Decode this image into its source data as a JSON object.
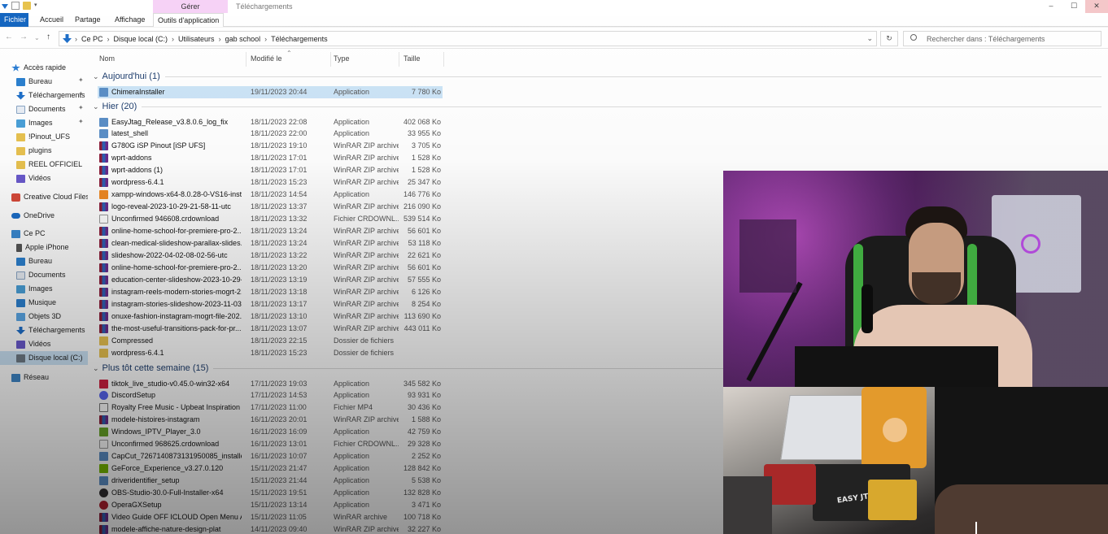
{
  "window": {
    "title": "Téléchargements",
    "context_tab": "Gérer"
  },
  "ribbon": {
    "tabs": [
      "Fichier",
      "Accueil",
      "Partage",
      "Affichage",
      "Outils d'application"
    ]
  },
  "address": {
    "crumbs": [
      "Ce PC",
      "Disque local (C:)",
      "Utilisateurs",
      "gab school",
      "Téléchargements"
    ],
    "search_placeholder": "Rechercher dans : Téléchargements"
  },
  "sidebar": {
    "items": [
      {
        "label": "Accès rapide",
        "icon": "star-icon",
        "pinned": false
      },
      {
        "label": "Bureau",
        "icon": "desktop-icon",
        "pinned": true
      },
      {
        "label": "Téléchargements",
        "icon": "download-icon",
        "pinned": true
      },
      {
        "label": "Documents",
        "icon": "documents-icon",
        "pinned": true
      },
      {
        "label": "Images",
        "icon": "images-icon",
        "pinned": true
      },
      {
        "label": "!Pinout_UFS",
        "icon": "folder-icon",
        "pinned": false
      },
      {
        "label": "plugins",
        "icon": "folder-icon",
        "pinned": false
      },
      {
        "label": "REEL OFFICIEL",
        "icon": "folder-icon",
        "pinned": false
      },
      {
        "label": "Vidéos",
        "icon": "videos-icon",
        "pinned": false
      },
      {
        "label": "Creative Cloud Files",
        "icon": "creative-cloud-icon",
        "pinned": false
      },
      {
        "label": "OneDrive",
        "icon": "onedrive-icon",
        "pinned": false
      },
      {
        "label": "Ce PC",
        "icon": "pc-icon",
        "pinned": false
      },
      {
        "label": "Apple iPhone",
        "icon": "phone-icon",
        "pinned": false
      },
      {
        "label": "Bureau",
        "icon": "desktop-icon",
        "pinned": false
      },
      {
        "label": "Documents",
        "icon": "documents-icon",
        "pinned": false
      },
      {
        "label": "Images",
        "icon": "images-icon",
        "pinned": false
      },
      {
        "label": "Musique",
        "icon": "music-icon",
        "pinned": false
      },
      {
        "label": "Objets 3D",
        "icon": "objects-3d-icon",
        "pinned": false
      },
      {
        "label": "Téléchargements",
        "icon": "download-icon",
        "pinned": false
      },
      {
        "label": "Vidéos",
        "icon": "videos-icon",
        "pinned": false
      },
      {
        "label": "Disque local (C:)",
        "icon": "disk-icon",
        "pinned": false
      },
      {
        "label": "Réseau",
        "icon": "network-icon",
        "pinned": false
      }
    ]
  },
  "columns": [
    "Nom",
    "Modifié le",
    "Type",
    "Taille"
  ],
  "groups": [
    {
      "label": "Aujourd'hui (1)",
      "files": [
        {
          "name": "ChimeraInstaller",
          "date": "19/11/2023 20:44",
          "type": "Application",
          "size": "7 780 Ko",
          "icon": "app",
          "selected": true
        }
      ]
    },
    {
      "label": "Hier (20)",
      "files": [
        {
          "name": "EasyJtag_Release_v3.8.0.6_log_fix",
          "date": "18/11/2023 22:08",
          "type": "Application",
          "size": "402 068 Ko",
          "icon": "app"
        },
        {
          "name": "latest_shell",
          "date": "18/11/2023 22:00",
          "type": "Application",
          "size": "33 955 Ko",
          "icon": "app"
        },
        {
          "name": "G780G iSP Pinout [iSP UFS]",
          "date": "18/11/2023 19:10",
          "type": "WinRAR ZIP archive",
          "size": "3 705 Ko",
          "icon": "zip"
        },
        {
          "name": "wprt-addons",
          "date": "18/11/2023 17:01",
          "type": "WinRAR ZIP archive",
          "size": "1 528 Ko",
          "icon": "zip"
        },
        {
          "name": "wprt-addons (1)",
          "date": "18/11/2023 17:01",
          "type": "WinRAR ZIP archive",
          "size": "1 528 Ko",
          "icon": "zip"
        },
        {
          "name": "wordpress-6.4.1",
          "date": "18/11/2023 15:23",
          "type": "WinRAR ZIP archive",
          "size": "25 347 Ko",
          "icon": "zip"
        },
        {
          "name": "xampp-windows-x64-8.0.28-0-VS16-inst...",
          "date": "18/11/2023 14:54",
          "type": "Application",
          "size": "146 776 Ko",
          "icon": "xampp"
        },
        {
          "name": "logo-reveal-2023-10-29-21-58-11-utc",
          "date": "18/11/2023 13:37",
          "type": "WinRAR ZIP archive",
          "size": "216 090 Ko",
          "icon": "zip"
        },
        {
          "name": "Unconfirmed 946608.crdownload",
          "date": "18/11/2023 13:32",
          "type": "Fichier CRDOWNL...",
          "size": "539 514 Ko",
          "icon": "crd"
        },
        {
          "name": "online-home-school-for-premiere-pro-2...",
          "date": "18/11/2023 13:24",
          "type": "WinRAR ZIP archive",
          "size": "56 601 Ko",
          "icon": "zip"
        },
        {
          "name": "clean-medical-slideshow-parallax-slides...",
          "date": "18/11/2023 13:24",
          "type": "WinRAR ZIP archive",
          "size": "53 118 Ko",
          "icon": "zip"
        },
        {
          "name": "slideshow-2022-04-02-08-02-56-utc",
          "date": "18/11/2023 13:22",
          "type": "WinRAR ZIP archive",
          "size": "22 621 Ko",
          "icon": "zip"
        },
        {
          "name": "online-home-school-for-premiere-pro-2...",
          "date": "18/11/2023 13:20",
          "type": "WinRAR ZIP archive",
          "size": "56 601 Ko",
          "icon": "zip"
        },
        {
          "name": "education-center-slideshow-2023-10-29-...",
          "date": "18/11/2023 13:19",
          "type": "WinRAR ZIP archive",
          "size": "57 555 Ko",
          "icon": "zip"
        },
        {
          "name": "instagram-reels-modern-stories-mogrt-2...",
          "date": "18/11/2023 13:18",
          "type": "WinRAR ZIP archive",
          "size": "6 126 Ko",
          "icon": "zip"
        },
        {
          "name": "instagram-stories-slideshow-2023-11-03-...",
          "date": "18/11/2023 13:17",
          "type": "WinRAR ZIP archive",
          "size": "8 254 Ko",
          "icon": "zip"
        },
        {
          "name": "onuxe-fashion-instagram-mogrt-file-202...",
          "date": "18/11/2023 13:10",
          "type": "WinRAR ZIP archive",
          "size": "113 690 Ko",
          "icon": "zip"
        },
        {
          "name": "the-most-useful-transitions-pack-for-pr...",
          "date": "18/11/2023 13:07",
          "type": "WinRAR ZIP archive",
          "size": "443 011 Ko",
          "icon": "zip"
        },
        {
          "name": "Compressed",
          "date": "18/11/2023 22:15",
          "type": "Dossier de fichiers",
          "size": "",
          "icon": "folder"
        },
        {
          "name": "wordpress-6.4.1",
          "date": "18/11/2023 15:23",
          "type": "Dossier de fichiers",
          "size": "",
          "icon": "folder"
        }
      ]
    },
    {
      "label": "Plus tôt cette semaine (15)",
      "files": [
        {
          "name": "tiktok_live_studio-v0.45.0-win32-x64",
          "date": "17/11/2023 19:03",
          "type": "Application",
          "size": "345 582 Ko",
          "icon": "tiktok"
        },
        {
          "name": "DiscordSetup",
          "date": "17/11/2023 14:53",
          "type": "Application",
          "size": "93 931 Ko",
          "icon": "discord"
        },
        {
          "name": "Royalty Free Music - Upbeat Inspiration _...",
          "date": "17/11/2023 11:00",
          "type": "Fichier MP4",
          "size": "30 436 Ko",
          "icon": "mp4"
        },
        {
          "name": "modele-histoires-instagram",
          "date": "16/11/2023 20:01",
          "type": "WinRAR ZIP archive",
          "size": "1 588 Ko",
          "icon": "zip"
        },
        {
          "name": "Windows_IPTV_Player_3.0",
          "date": "16/11/2023 16:09",
          "type": "Application",
          "size": "42 759 Ko",
          "icon": "green"
        },
        {
          "name": "Unconfirmed 968625.crdownload",
          "date": "16/11/2023 13:01",
          "type": "Fichier CRDOWNL...",
          "size": "29 328 Ko",
          "icon": "crd"
        },
        {
          "name": "CapCut_7267140873131950085_installer",
          "date": "16/11/2023 10:07",
          "type": "Application",
          "size": "2 252 Ko",
          "icon": "app"
        },
        {
          "name": "GeForce_Experience_v3.27.0.120",
          "date": "15/11/2023 21:47",
          "type": "Application",
          "size": "128 842 Ko",
          "icon": "nvidia"
        },
        {
          "name": "driveridentifier_setup",
          "date": "15/11/2023 21:44",
          "type": "Application",
          "size": "5 538 Ko",
          "icon": "app"
        },
        {
          "name": "OBS-Studio-30.0-Full-Installer-x64",
          "date": "15/11/2023 19:51",
          "type": "Application",
          "size": "132 828 Ko",
          "icon": "obs"
        },
        {
          "name": "OperaGXSetup",
          "date": "15/11/2023 13:14",
          "type": "Application",
          "size": "3 471 Ko",
          "icon": "opera"
        },
        {
          "name": "Video Guide OFF ICLOUD Open Menu All...",
          "date": "15/11/2023 11:05",
          "type": "WinRAR archive",
          "size": "100 718 Ko",
          "icon": "zip"
        },
        {
          "name": "modele-affiche-nature-design-plat",
          "date": "14/11/2023 09:40",
          "type": "WinRAR ZIP archive",
          "size": "32 227 Ko",
          "icon": "zip"
        }
      ]
    }
  ],
  "webcam": {
    "box_text": "EASY JTAG"
  }
}
